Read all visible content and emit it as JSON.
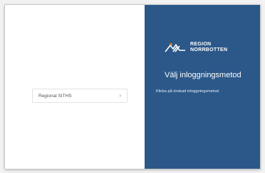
{
  "login_methods": [
    {
      "label": "Regional SITHS",
      "icon": "chevron-right-icon",
      "glyph": "›"
    }
  ],
  "brand": {
    "line1": "REGION",
    "line2": "NORRBOTTEN",
    "logo_icon": "mountain-logo-icon",
    "accent_color": "#e8852a",
    "panel_color": "#2b5889"
  },
  "panel": {
    "title": "Välj inloggningsmetod",
    "subtitle": "Klicka på önskad inloggningsmetod."
  }
}
